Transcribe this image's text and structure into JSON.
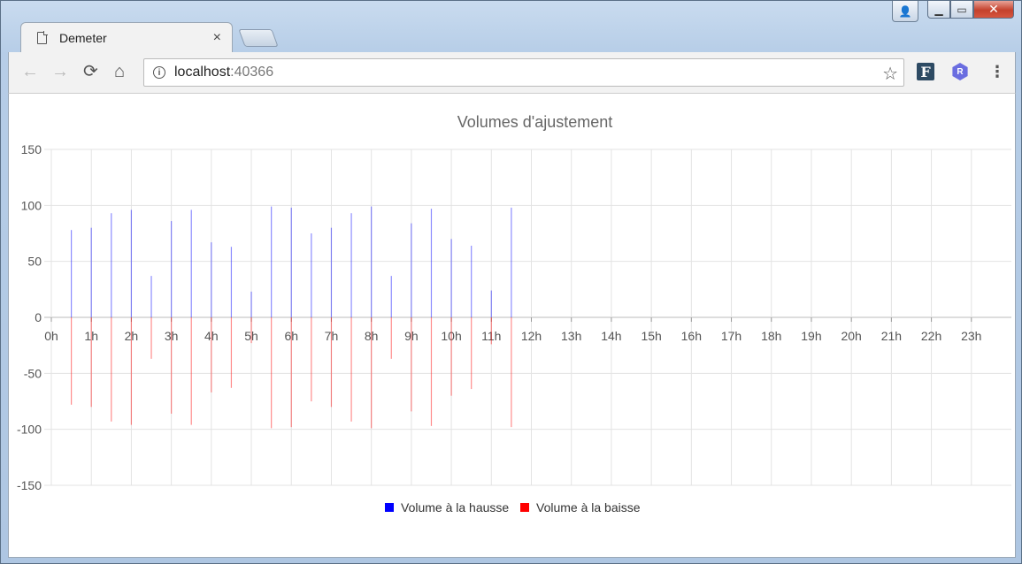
{
  "window": {
    "tab_title": "Demeter",
    "tab_close": "×",
    "address": {
      "host": "localhost",
      "port": ":40366"
    },
    "controls": {
      "back": "←",
      "forward": "→",
      "reload": "⟳",
      "home": "⌂",
      "star": "☆",
      "menu": "⋮",
      "minimize": "▁",
      "maximize": "▭",
      "close": "✕"
    },
    "extensions": [
      {
        "label": "F",
        "icon": "f-extension-icon"
      },
      {
        "label": "R",
        "icon": "r-extension-icon"
      }
    ]
  },
  "chart_data": {
    "type": "bar",
    "title": "Volumes d'ajustement",
    "xlabel": "",
    "ylabel": "",
    "ylim": [
      -150,
      150
    ],
    "yticks": [
      150,
      100,
      50,
      0,
      -50,
      -100,
      -150
    ],
    "categories": [
      "0h",
      "1h",
      "2h",
      "3h",
      "4h",
      "5h",
      "6h",
      "7h",
      "8h",
      "9h",
      "10h",
      "11h",
      "12h",
      "13h",
      "14h",
      "15h",
      "16h",
      "17h",
      "18h",
      "19h",
      "20h",
      "21h",
      "22h",
      "23h"
    ],
    "x_hours": [
      0.5,
      1,
      1.5,
      2,
      2.5,
      3,
      3.5,
      4,
      4.5,
      5,
      5.5,
      6,
      6.5,
      7,
      7.5,
      8,
      8.5,
      9,
      9.5,
      10,
      10.5,
      11,
      11.5
    ],
    "series": [
      {
        "name": "Volume à la hausse",
        "color": "#0000ff",
        "values": [
          78,
          80,
          93,
          96,
          37,
          86,
          96,
          67,
          63,
          23,
          99,
          98,
          75,
          80,
          93,
          99,
          37,
          84,
          97,
          70,
          64,
          24,
          98
        ]
      },
      {
        "name": "Volume à la baisse",
        "color": "#ff0000",
        "values": [
          -78,
          -80,
          -93,
          -96,
          -37,
          -86,
          -96,
          -67,
          -63,
          -23,
          -99,
          -98,
          -75,
          -80,
          -93,
          -99,
          -37,
          -84,
          -97,
          -70,
          -64,
          -24,
          -98
        ]
      }
    ],
    "grid": true,
    "legend": "bottom-center"
  }
}
